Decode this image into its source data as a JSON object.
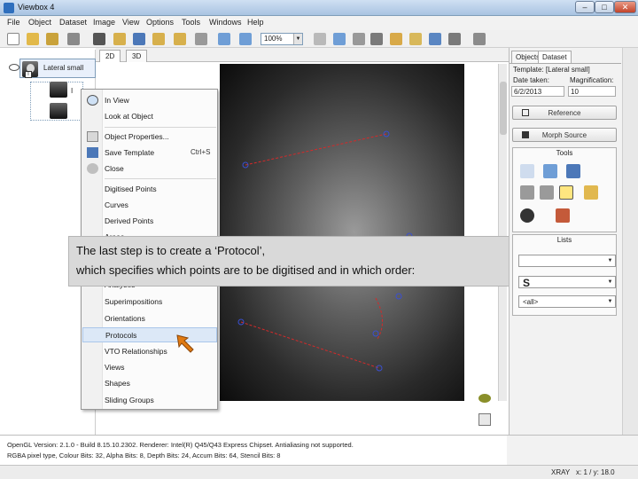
{
  "window": {
    "title": "Viewbox 4",
    "minimize": "–",
    "maximize": "□",
    "close": "✕"
  },
  "menu": [
    "File",
    "Object",
    "Dataset",
    "Image",
    "View",
    "Options",
    "Tools",
    "Windows",
    "Help"
  ],
  "toolbar": {
    "zoom_value": "100%"
  },
  "view_tabs": [
    "2D",
    "3D"
  ],
  "object_tree": {
    "root_label": "Lateral small",
    "child_label": "I",
    "badge": "T"
  },
  "context_menu": {
    "items": [
      {
        "label": "In View",
        "shortcut": ""
      },
      {
        "label": "Look at Object",
        "shortcut": ""
      },
      {
        "label": "Object Properties...",
        "shortcut": ""
      },
      {
        "label": "Save Template",
        "shortcut": "Ctrl+S"
      },
      {
        "label": "Close",
        "shortcut": ""
      },
      {
        "label": "Digitised Points",
        "shortcut": ""
      },
      {
        "label": "Curves",
        "shortcut": ""
      },
      {
        "label": "Derived Points",
        "shortcut": ""
      },
      {
        "label": "Areas",
        "shortcut": ""
      },
      {
        "label": "Analyses",
        "shortcut": ""
      },
      {
        "label": "Superimpositions",
        "shortcut": ""
      },
      {
        "label": "Orientations",
        "shortcut": ""
      },
      {
        "label": "Protocols",
        "shortcut": ""
      },
      {
        "label": "VTO Relationships",
        "shortcut": ""
      },
      {
        "label": "Views",
        "shortcut": ""
      },
      {
        "label": "Shapes",
        "shortcut": ""
      },
      {
        "label": "Sliding Groups",
        "shortcut": ""
      }
    ],
    "highlighted": "Protocols"
  },
  "callout": {
    "line1": "The last step is to create a ‘Protocol’,",
    "line2": "which specifies which points are to be digitised and in which order:"
  },
  "right_panel": {
    "tabs": [
      "Objects",
      "Dataset"
    ],
    "active_tab": "Dataset",
    "template_label": "Template: [Lateral small]",
    "date_label": "Date taken:",
    "date_value": "6/2/2013",
    "magnification_label": "Magnification:",
    "magnification_value": "10",
    "reference_button": "Reference",
    "morph_button": "Morph Source",
    "tools_title": "Tools",
    "lists_title": "Lists",
    "dropdown_1": "",
    "dropdown_2": "S",
    "dropdown_3": "<all>"
  },
  "console": {
    "line1": "OpenGL Version: 2.1.0 - Build 8.15.10.2302. Renderer: Intel(R) Q45/Q43 Express Chipset. Antialiasing not supported.",
    "line2": "RGBA pixel type, Colour Bits: 32, Alpha Bits: 8, Depth Bits: 24, Accum Bits: 64, Stencil Bits: 8"
  },
  "status": {
    "mode": "XRAY",
    "coords": "x: 1 / y: 18.0"
  },
  "colors": {
    "highlight": "#dce8f7",
    "callout_bg": "#d9d9d9",
    "landmark": "#3a4fd1",
    "trace_line": "#d42a2a",
    "cursor_arrow": "#e07a12"
  }
}
